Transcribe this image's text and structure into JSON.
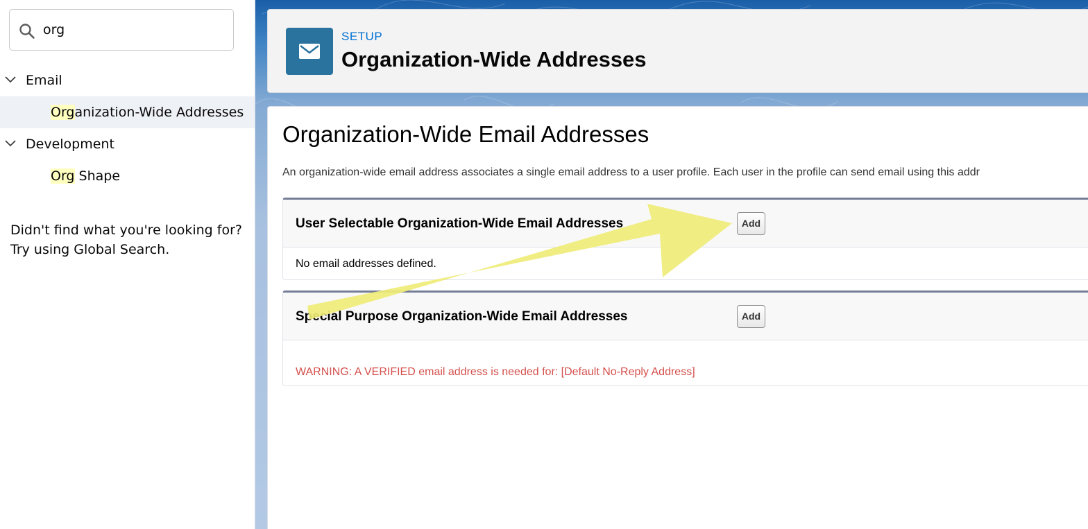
{
  "sidebar": {
    "search": {
      "value": "org",
      "placeholder": ""
    },
    "groups": [
      {
        "label": "Email",
        "items": [
          {
            "match": "Org",
            "rest": "anization-Wide Addresses",
            "selected": true
          }
        ]
      },
      {
        "label": "Development",
        "items": [
          {
            "match": "Org",
            "rest": " Shape",
            "selected": false
          }
        ]
      }
    ],
    "help_line1": "Didn't find what you're looking for?",
    "help_line2": "Try using Global Search."
  },
  "header": {
    "eyebrow": "SETUP",
    "title": "Organization-Wide Addresses",
    "icon": "email-icon"
  },
  "content": {
    "title": "Organization-Wide Email Addresses",
    "description": "An organization-wide email address associates a single email address to a user profile. Each user in the profile can send email using this addr",
    "sections": [
      {
        "title": "User Selectable Organization-Wide Email Addresses",
        "add_label": "Add",
        "body": "No email addresses defined."
      },
      {
        "title": "Special Purpose Organization-Wide Email Addresses",
        "add_label": "Add",
        "body": "WARNING: A VERIFIED email address is needed for: [Default No-Reply Address]"
      }
    ]
  },
  "colors": {
    "accent_link": "#0070d2",
    "icon_bg": "#2a739e",
    "warning": "#d4504c",
    "highlight": "#ffffc0",
    "annotation_arrow": "#efec78"
  }
}
